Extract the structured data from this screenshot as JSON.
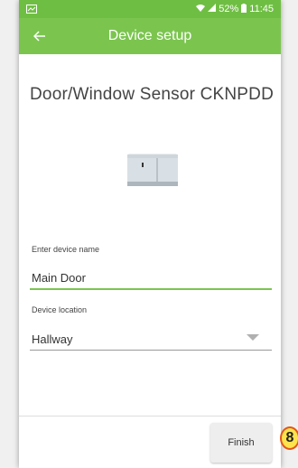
{
  "statusbar": {
    "battery": "52%",
    "time": "11:45"
  },
  "appbar": {
    "title": "Device setup",
    "back_icon": "arrow-left-icon"
  },
  "device": {
    "title": "Door/Window Sensor CKNPDD"
  },
  "form": {
    "name_label": "Enter device name",
    "name_value": "Main Door",
    "location_label": "Device location",
    "location_value": "Hallway"
  },
  "footer": {
    "finish_label": "Finish"
  },
  "annotation": {
    "step_number": "8"
  },
  "colors": {
    "accent": "#7bc54f",
    "badge_fill": "#ffe34d",
    "badge_border": "#e2561a"
  }
}
